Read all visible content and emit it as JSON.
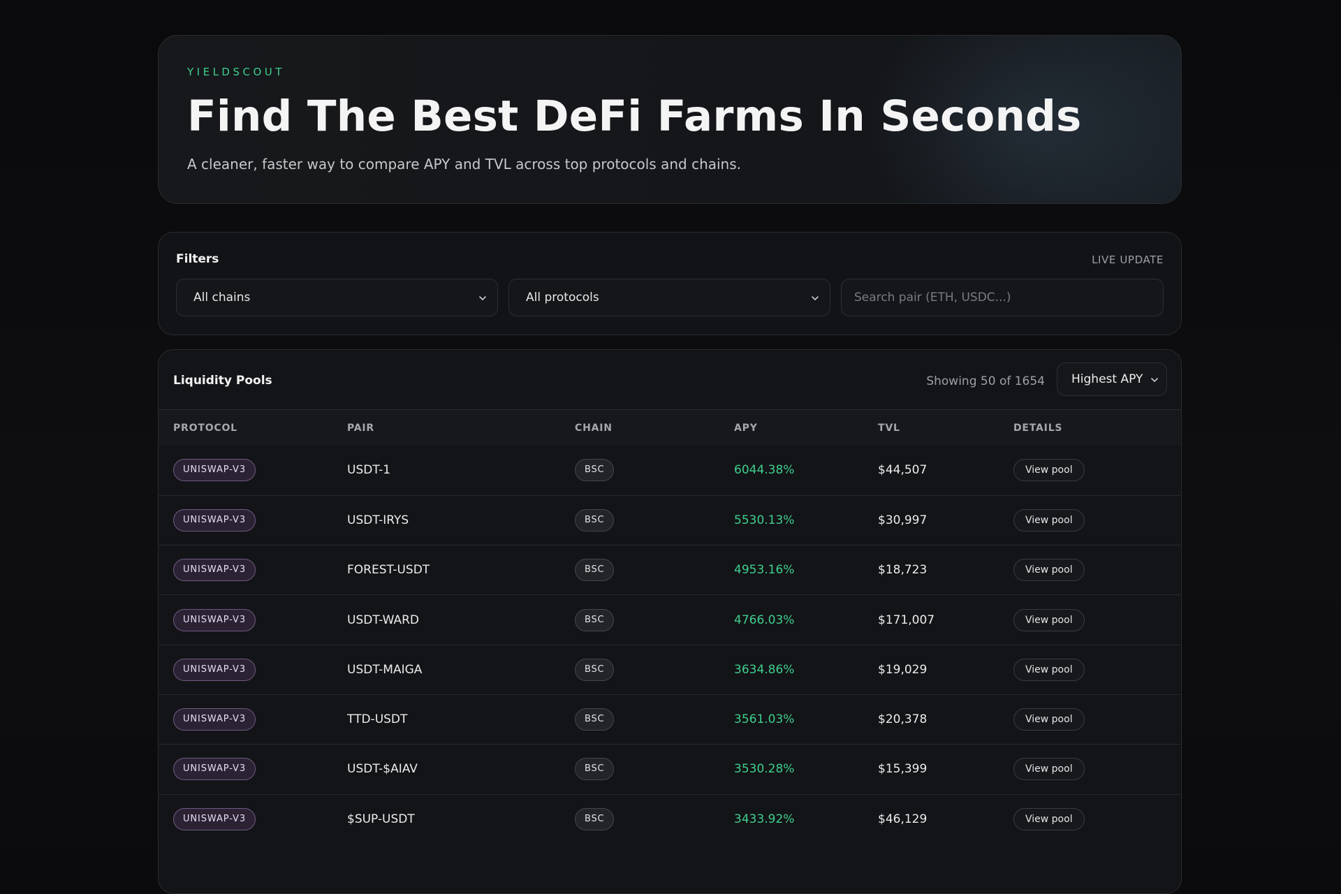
{
  "hero": {
    "eyebrow": "YIELDSCOUT",
    "title": "Find The Best DeFi Farms In Seconds",
    "subtitle": "A cleaner, faster way to compare APY and TVL across top protocols and chains."
  },
  "filters": {
    "title": "Filters",
    "live_label": "LIVE UPDATE",
    "chain_select": "All chains",
    "protocol_select": "All protocols",
    "search_placeholder": "Search pair (ETH, USDC...)"
  },
  "pools": {
    "title": "Liquidity Pools",
    "showing": "Showing 50 of 1654",
    "sort_select": "Highest APY",
    "columns": [
      "PROTOCOL",
      "PAIR",
      "CHAIN",
      "APY",
      "TVL",
      "DETAILS"
    ],
    "rows": [
      {
        "protocol": "UNISWAP-V3",
        "pair": "USDT-1",
        "chain": "BSC",
        "apy": "6044.38%",
        "tvl": "$44,507",
        "action": "View pool"
      },
      {
        "protocol": "UNISWAP-V3",
        "pair": "USDT-IRYS",
        "chain": "BSC",
        "apy": "5530.13%",
        "tvl": "$30,997",
        "action": "View pool"
      },
      {
        "protocol": "UNISWAP-V3",
        "pair": "FOREST-USDT",
        "chain": "BSC",
        "apy": "4953.16%",
        "tvl": "$18,723",
        "action": "View pool"
      },
      {
        "protocol": "UNISWAP-V3",
        "pair": "USDT-WARD",
        "chain": "BSC",
        "apy": "4766.03%",
        "tvl": "$171,007",
        "action": "View pool"
      },
      {
        "protocol": "UNISWAP-V3",
        "pair": "USDT-MAIGA",
        "chain": "BSC",
        "apy": "3634.86%",
        "tvl": "$19,029",
        "action": "View pool"
      },
      {
        "protocol": "UNISWAP-V3",
        "pair": "TTD-USDT",
        "chain": "BSC",
        "apy": "3561.03%",
        "tvl": "$20,378",
        "action": "View pool"
      },
      {
        "protocol": "UNISWAP-V3",
        "pair": "USDT-$AIAV",
        "chain": "BSC",
        "apy": "3530.28%",
        "tvl": "$15,399",
        "action": "View pool"
      },
      {
        "protocol": "UNISWAP-V3",
        "pair": "$SUP-USDT",
        "chain": "BSC",
        "apy": "3433.92%",
        "tvl": "$46,129",
        "action": "View pool"
      }
    ]
  },
  "colors": {
    "accent_green": "#3ecf8e",
    "protocol_tag_border": "#6f5a83",
    "background": "#0b0b0d"
  },
  "icons": {
    "select_chevron": "chevron-down-icon"
  }
}
